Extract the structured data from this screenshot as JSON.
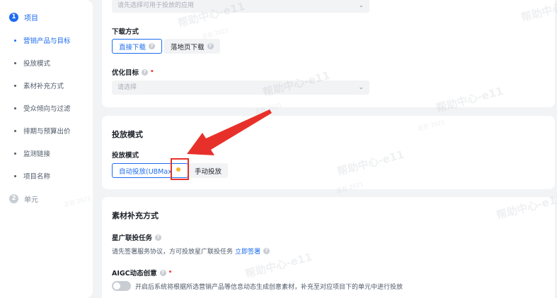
{
  "sidebar": {
    "step1": {
      "num": "1",
      "label": "项目"
    },
    "items": [
      {
        "label": "营销产品与目标"
      },
      {
        "label": "投放模式"
      },
      {
        "label": "素材补充方式"
      },
      {
        "label": "受众倾向与过滤"
      },
      {
        "label": "排期与预算出价"
      },
      {
        "label": "监测链接"
      },
      {
        "label": "项目名称"
      }
    ],
    "step2": {
      "num": "2",
      "label": "单元"
    }
  },
  "card1": {
    "app_select_placeholder": "请先选择可用于投放的应用",
    "download_label": "下载方式",
    "download_options": [
      "直接下载",
      "落地页下载"
    ],
    "goal_label": "优化目标",
    "goal_placeholder": "请选择"
  },
  "card2": {
    "title": "投放模式",
    "mode_label": "投放模式",
    "mode_options": [
      "自动投放(UBMax",
      "手动投放"
    ]
  },
  "card3": {
    "title": "素材补充方式",
    "star_label": "星广联投任务",
    "star_note": "请先签署服务协议，方可投放星广联投任务",
    "star_link": "立即签署",
    "aigc_label": "AIGC动态创意",
    "aigc_desc": "开启后系统将根据所选营销产品等信息动态生成创意素材，补充至对应项目下的单元中进行投放"
  },
  "watermarks": {
    "big": "帮助中心-e11",
    "small": "正在 2021"
  },
  "icons": {
    "help": "?",
    "chevron": "⌄"
  },
  "colors": {
    "accent": "#1d6cf0",
    "annotation": "#e8302a"
  }
}
